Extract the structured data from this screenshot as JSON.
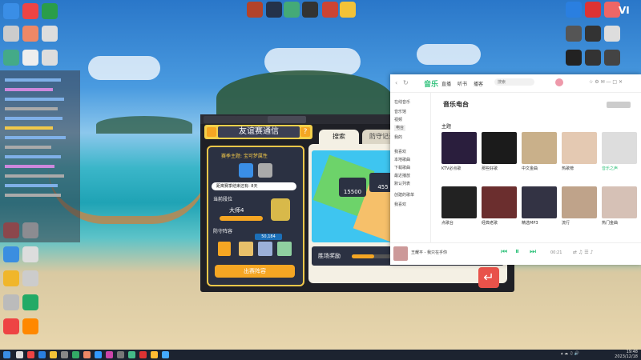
{
  "desktop": {
    "top_icons": [
      "",
      "",
      "",
      "",
      ""
    ],
    "right_badge": "VI"
  },
  "game": {
    "header_title": "友谊赛通信",
    "theme": "赛季主题: 宝可梦属性",
    "progress_text": "距离赛季结束还有: 8天",
    "rank_label": "当前段位",
    "rank_value": "大师4",
    "defense_label": "防守阵容",
    "power": "50,184",
    "action_button": "出赛阵容",
    "tab_search": "搜索",
    "tab_defense": "防守记录",
    "score_left": "15500",
    "score_right": "455",
    "prize_label": "胜场奖励",
    "skip_label": "跳过"
  },
  "music": {
    "tabs": [
      "音乐",
      "直播",
      "听书",
      "播客"
    ],
    "search_placeholder": "搜索",
    "section_title": "音乐电台",
    "subheading": "主题",
    "sidebar": [
      "在线音乐",
      "音乐馆",
      "视频",
      "电台",
      "我的",
      "我喜欢",
      "本地歌曲",
      "下载歌曲",
      "最近播放",
      "默认列表",
      "创建的歌单",
      "我喜欢"
    ],
    "cards": [
      {
        "label": "KTV必点歌"
      },
      {
        "label": "那些好歌"
      },
      {
        "label": "中文金曲"
      },
      {
        "label": "热歌榜"
      },
      {
        "label": "音乐之声"
      },
      {
        "label": "点歌台"
      },
      {
        "label": "经典老歌"
      },
      {
        "label": "精选MP3"
      },
      {
        "label": "流行"
      },
      {
        "label": "热门金曲"
      }
    ],
    "player_song": "王耀平 - 我只在乎你",
    "player_time": "00:21"
  },
  "taskbar": {
    "time": "19:48",
    "date": "2023/12/18"
  },
  "colors": {
    "game_accent": "#f2c84a",
    "music_brand": "#31c27c"
  }
}
